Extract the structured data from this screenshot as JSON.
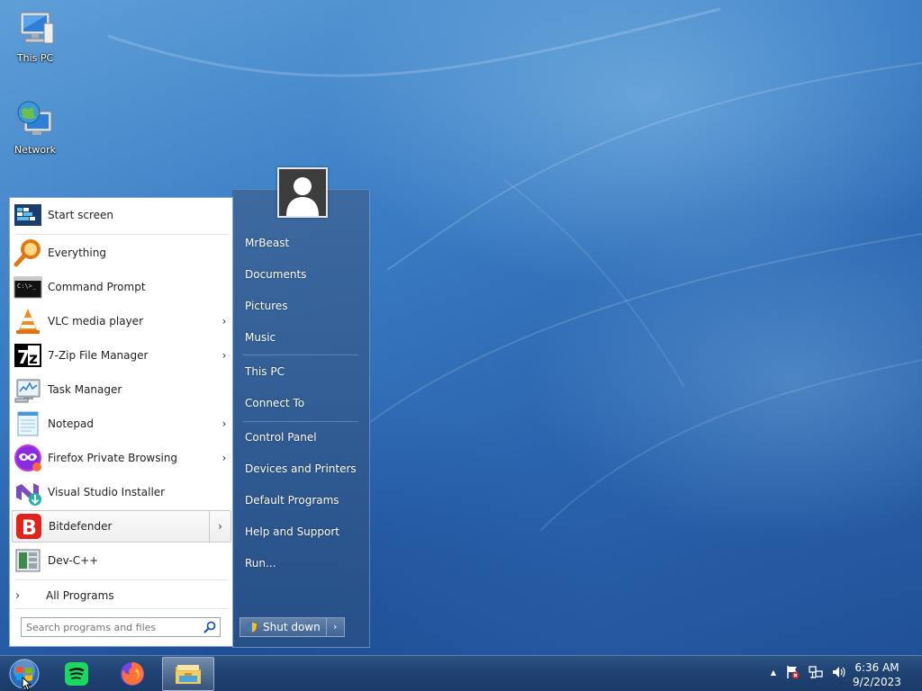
{
  "desktop": {
    "icons": [
      {
        "label": "This PC"
      },
      {
        "label": "Network"
      }
    ]
  },
  "start_menu": {
    "programs": [
      {
        "label": "Start screen",
        "icon": "start-screen-icon",
        "has_arrow": false
      },
      {
        "label": "Everything",
        "icon": "magnifier-icon",
        "has_arrow": false
      },
      {
        "label": "Command Prompt",
        "icon": "command-prompt-icon",
        "has_arrow": false
      },
      {
        "label": "VLC media player",
        "icon": "vlc-cone-icon",
        "has_arrow": true,
        "arrow": "›"
      },
      {
        "label": "7-Zip File Manager",
        "icon": "7zip-icon",
        "has_arrow": true,
        "arrow": "›"
      },
      {
        "label": "Task Manager",
        "icon": "task-manager-icon",
        "has_arrow": false
      },
      {
        "label": "Notepad",
        "icon": "notepad-icon",
        "has_arrow": true,
        "arrow": "›"
      },
      {
        "label": "Firefox Private Browsing",
        "icon": "firefox-private-icon",
        "has_arrow": true,
        "arrow": "›"
      },
      {
        "label": "Visual Studio Installer",
        "icon": "visual-studio-installer-icon",
        "has_arrow": false
      },
      {
        "label": "Bitdefender",
        "icon": "bitdefender-icon",
        "has_arrow": true,
        "arrow": "›",
        "highlighted": true
      },
      {
        "label": "Dev-C++",
        "icon": "dev-cpp-icon",
        "has_arrow": false
      }
    ],
    "all_programs": {
      "label": "All Programs",
      "chevron": "›"
    },
    "search": {
      "placeholder": "Search programs and files"
    },
    "right_links": [
      {
        "label": "MrBeast"
      },
      {
        "label": "Documents"
      },
      {
        "label": "Pictures"
      },
      {
        "label": "Music"
      },
      {
        "label": "This PC"
      },
      {
        "label": "Connect To"
      },
      {
        "label": "Control Panel"
      },
      {
        "label": "Devices and Printers"
      },
      {
        "label": "Default Programs"
      },
      {
        "label": "Help and Support"
      },
      {
        "label": "Run..."
      }
    ],
    "shutdown": {
      "label": "Shut down",
      "arrow": "›"
    }
  },
  "taskbar": {
    "buttons": [
      {
        "icon": "start-orb-icon"
      },
      {
        "icon": "spotify-icon"
      },
      {
        "icon": "firefox-icon"
      },
      {
        "icon": "file-explorer-icon",
        "active": true
      }
    ],
    "tray": {
      "expand_glyph": "▲",
      "icons": [
        "action-center-flag-icon",
        "network-icon",
        "speaker-icon"
      ]
    },
    "clock": {
      "time": "6:36 AM",
      "date": "9/2/2023"
    }
  }
}
